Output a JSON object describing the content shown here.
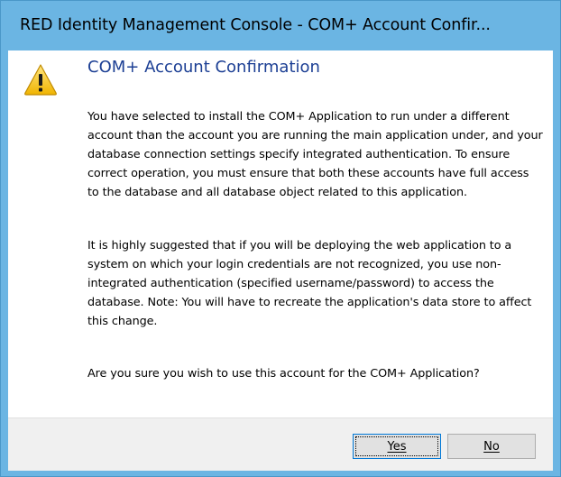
{
  "window": {
    "title": "RED Identity Management Console - COM+ Account Confir..."
  },
  "dialog": {
    "icon": "warning-icon",
    "heading": "COM+ Account Confirmation",
    "paragraphs": [
      "You have selected to install the COM+ Application to run under a different account than the account you are running the main application under, and your database connection settings specify integrated authentication.  To ensure correct operation, you must ensure that both these accounts have full access to the database and all database object related to this application.",
      "It is highly suggested that if you will be deploying the web application to a system on which your login credentials are not recognized, you use non-integrated authentication (specified username/password) to access the database.  Note: You will have to recreate the application's data store to affect this change.",
      "Are you sure you wish to use this account for the COM+ Application?"
    ]
  },
  "buttons": {
    "yes_label": "Yes",
    "no_label": "No"
  },
  "colors": {
    "frame": "#6bb5e3",
    "heading": "#1c3f94",
    "button_bar": "#f0f0f0",
    "focus_border": "#0078d7",
    "warning_fill": "#f7c600"
  }
}
